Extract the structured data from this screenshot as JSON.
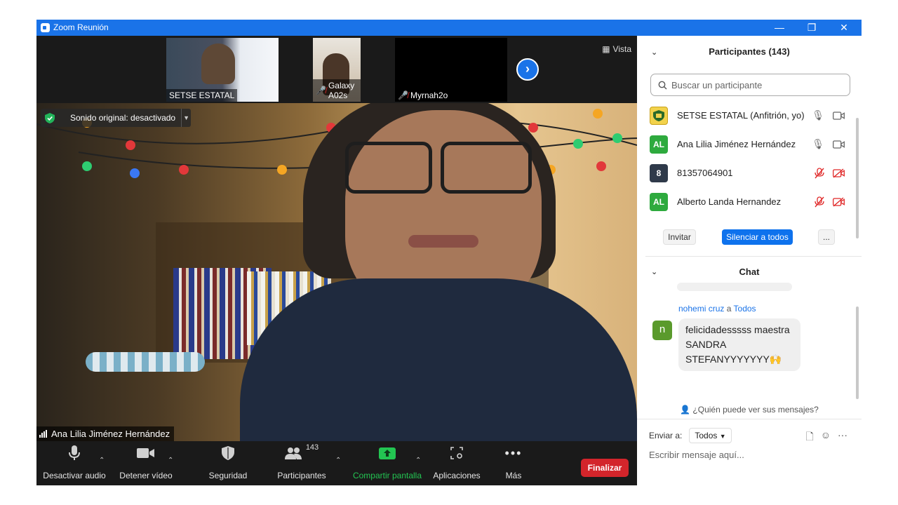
{
  "window": {
    "title": "Zoom Reunión"
  },
  "thumbnails": [
    {
      "name": "SETSE ESTATAL",
      "muted": false
    },
    {
      "name": "Galaxy A02s",
      "muted": true
    },
    {
      "name": "Myrnah2o",
      "muted": true
    }
  ],
  "view_label": "Vista",
  "sound_status": "Sonido original: desactivado",
  "active_speaker": "Ana Lilia Jiménez Hernández",
  "toolbar": {
    "mute_label": "Desactivar audio",
    "video_label": "Detener vídeo",
    "security_label": "Seguridad",
    "participants_label": "Participantes",
    "participants_count": "143",
    "share_label": "Compartir pantalla",
    "apps_label": "Aplicaciones",
    "more_label": "Más",
    "end_label": "Finalizar"
  },
  "participants_panel": {
    "title": "Participantes (143)",
    "search_placeholder": "Buscar un participante",
    "items": [
      {
        "initials": "",
        "name": "SETSE ESTATAL (Anfitrión, yo)",
        "avatar_color": "#f2d24b",
        "mic": "on"
      },
      {
        "initials": "AL",
        "name": "Ana Lilia Jiménez Hernández",
        "avatar_color": "#2eaa3e",
        "mic": "on"
      },
      {
        "initials": "8",
        "name": "81357064901",
        "avatar_color": "#2f3a4a",
        "mic": "off"
      },
      {
        "initials": "AL",
        "name": "Alberto Landa Hernandez",
        "avatar_color": "#2eaa3e",
        "mic": "off"
      }
    ],
    "invite_label": "Invitar",
    "mute_all_label": "Silenciar a todos",
    "more_label": "..."
  },
  "chat": {
    "title": "Chat",
    "message": {
      "sender": "nohemi cruz",
      "to_word": "a",
      "recipient": "Todos",
      "avatar": "n",
      "text": "felicidadesssss maestra SANDRA STEFANYYYYYYY🙌"
    },
    "who_sees": "¿Quién puede ver sus mensajes?",
    "send_to_label": "Enviar a:",
    "send_to_value": "Todos",
    "compose_placeholder": "Escribir mensaje aquí..."
  }
}
